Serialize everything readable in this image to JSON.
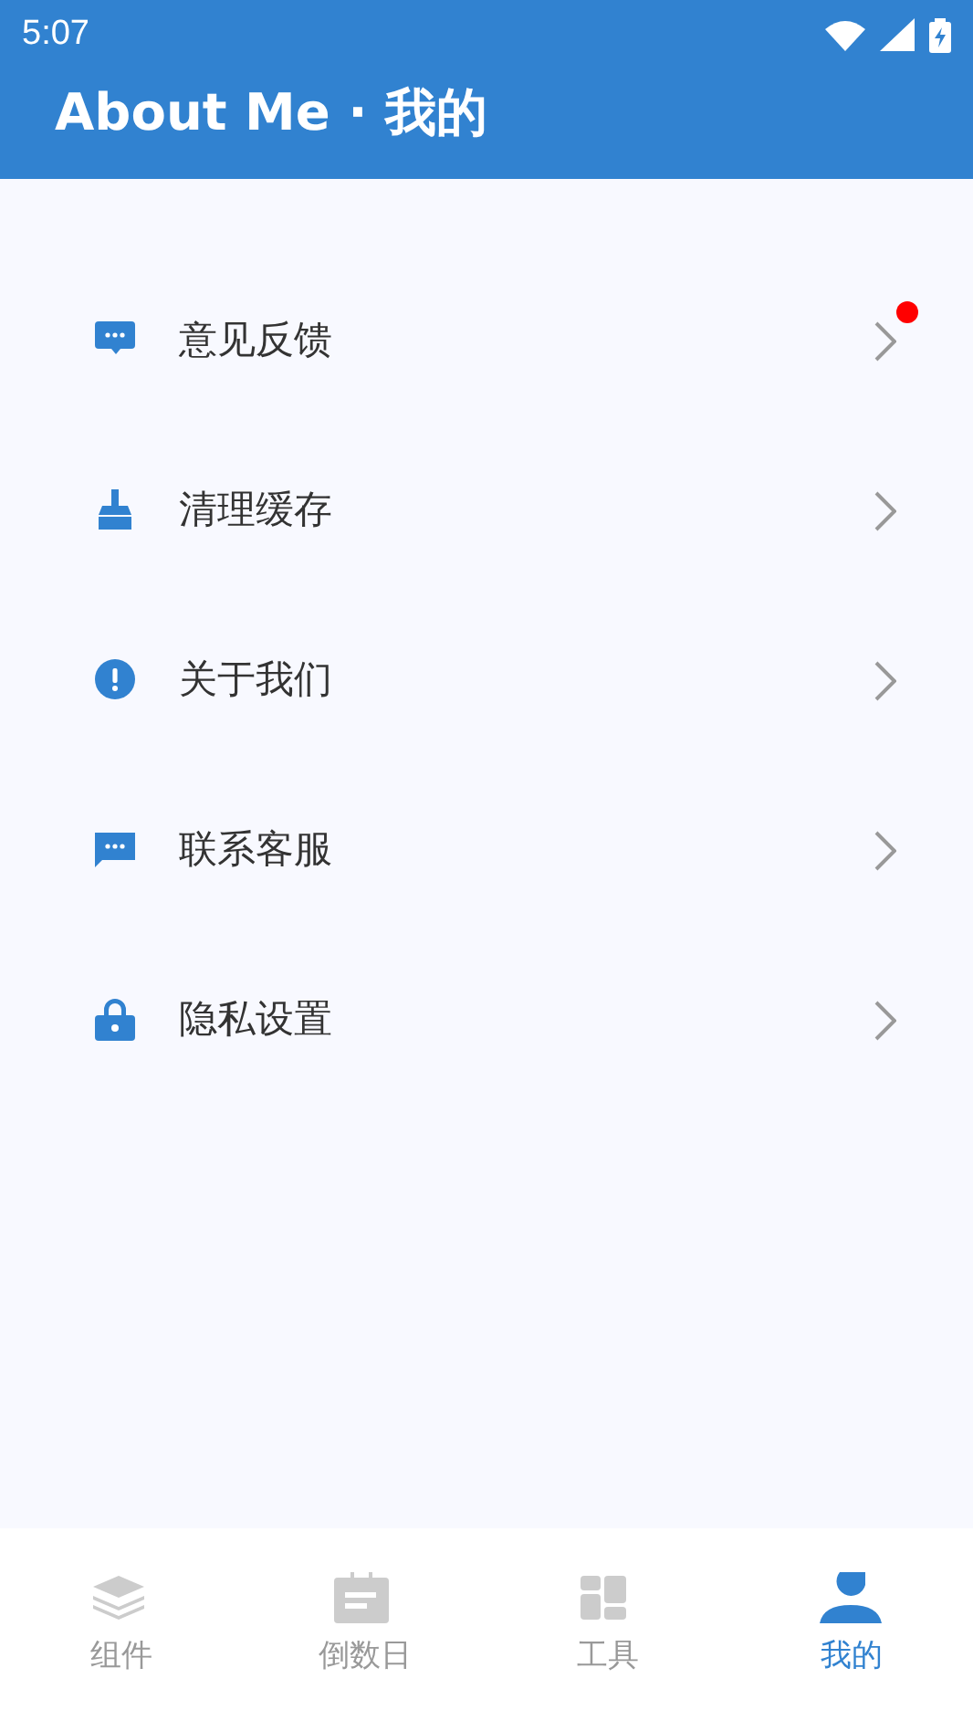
{
  "status_bar": {
    "time": "5:07"
  },
  "header": {
    "title": "About Me · 我的"
  },
  "menu": [
    {
      "kind": "feedback",
      "label": "意见反馈",
      "badge": true
    },
    {
      "kind": "broom",
      "label": "清理缓存",
      "badge": false
    },
    {
      "kind": "info",
      "label": "关于我们",
      "badge": false
    },
    {
      "kind": "message",
      "label": "联系客服",
      "badge": false
    },
    {
      "kind": "lock",
      "label": "隐私设置",
      "badge": false
    }
  ],
  "bottom_nav": [
    {
      "kind": "layers",
      "label": "组件",
      "selected": false
    },
    {
      "kind": "calendar",
      "label": "倒数日",
      "selected": false
    },
    {
      "kind": "dashboard",
      "label": "工具",
      "selected": false
    },
    {
      "kind": "person",
      "label": "我的",
      "selected": true
    }
  ]
}
